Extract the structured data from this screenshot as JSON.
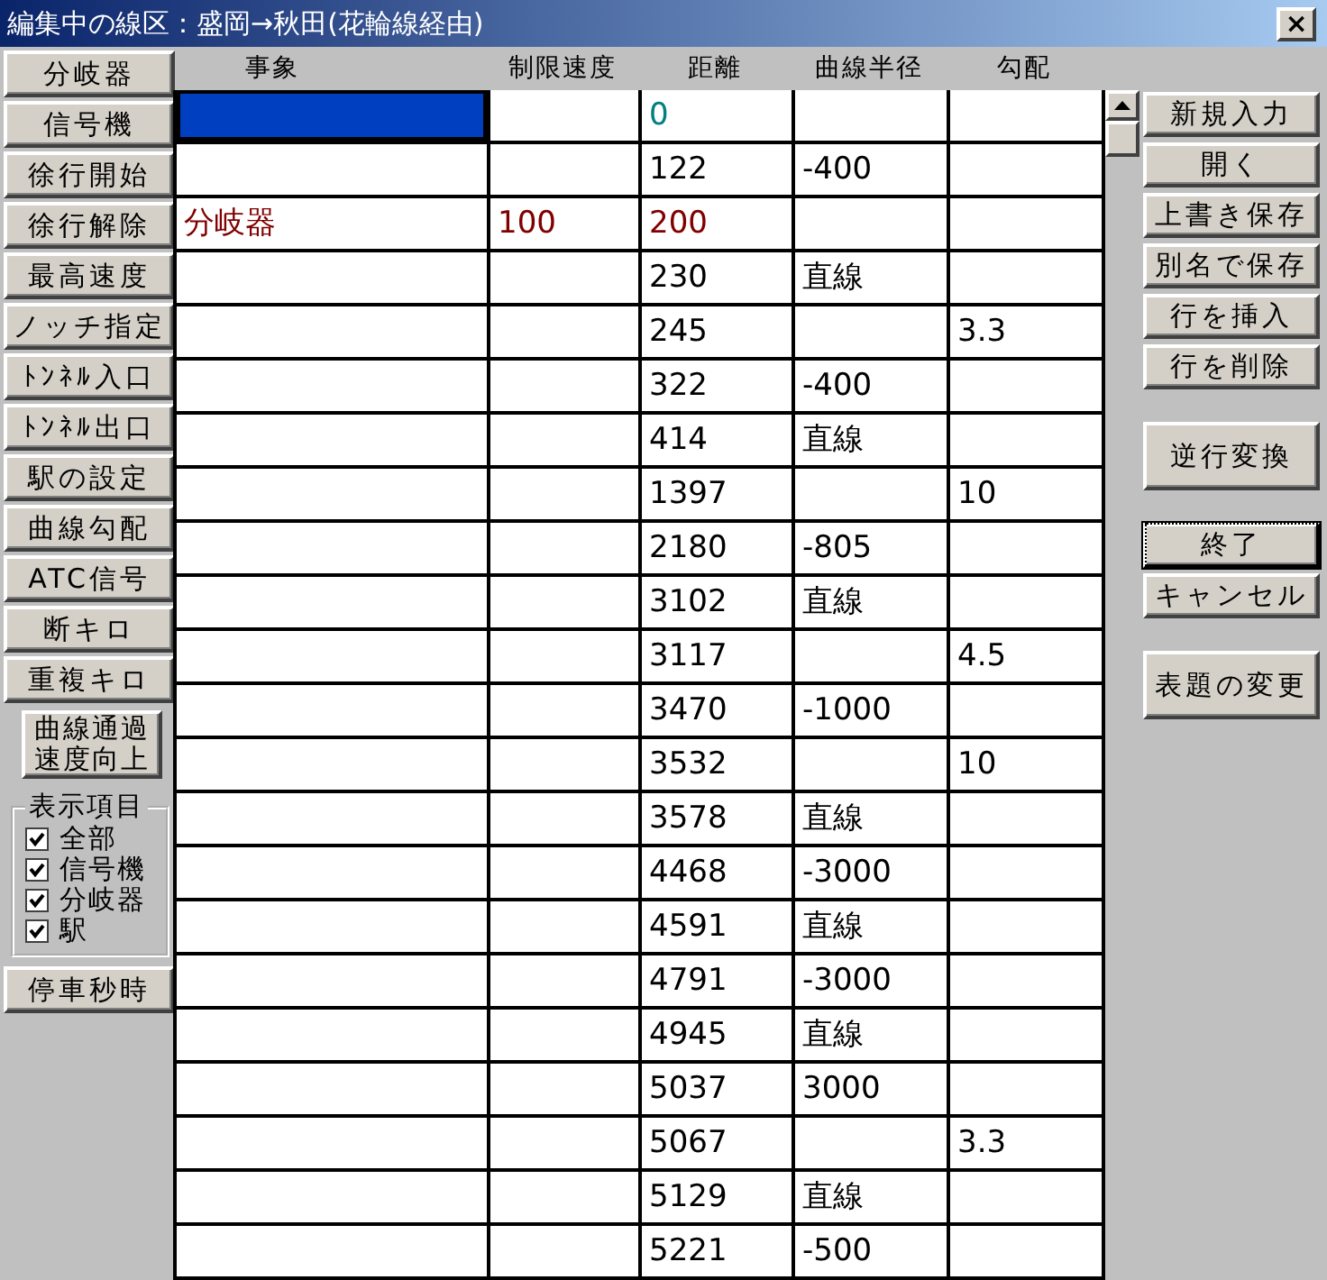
{
  "window": {
    "title": "編集中の線区：盛岡→秋田(花輪線経由)",
    "close": "×"
  },
  "left_buttons": [
    {
      "label": "分岐器",
      "kind": "normal"
    },
    {
      "label": "信号機",
      "kind": "normal"
    },
    {
      "label": "徐行開始",
      "kind": "normal"
    },
    {
      "label": "徐行解除",
      "kind": "normal"
    },
    {
      "label": "最高速度",
      "kind": "normal"
    },
    {
      "label": "ノッチ指定",
      "kind": "normal"
    },
    {
      "label": "ﾄﾝﾈﾙ入口",
      "kind": "normal"
    },
    {
      "label": "ﾄﾝﾈﾙ出口",
      "kind": "normal"
    },
    {
      "label": "駅の設定",
      "kind": "normal"
    },
    {
      "label": "曲線勾配",
      "kind": "normal"
    },
    {
      "label": "ATC信号",
      "kind": "normal"
    },
    {
      "label": "断キロ",
      "kind": "normal"
    },
    {
      "label": "重複キロ",
      "kind": "normal"
    },
    {
      "label": "曲線通過速度向上",
      "kind": "small"
    }
  ],
  "display_items": {
    "title": "表示項目",
    "items": [
      {
        "label": "全部",
        "checked": true
      },
      {
        "label": "信号機",
        "checked": true
      },
      {
        "label": "分岐器",
        "checked": true
      },
      {
        "label": "駅",
        "checked": true
      }
    ]
  },
  "bottom_button": {
    "label": "停車秒時"
  },
  "table": {
    "columns": [
      "事象",
      "制限速度",
      "距離",
      "曲線半径",
      "勾配"
    ],
    "rows": [
      {
        "cells": [
          "",
          "",
          "0",
          "",
          ""
        ],
        "selected": true,
        "color": "#008080"
      },
      {
        "cells": [
          "",
          "",
          "122",
          "-400",
          ""
        ],
        "selected": false,
        "color": "#000000"
      },
      {
        "cells": [
          "分岐器",
          "100",
          "200",
          "",
          ""
        ],
        "selected": false,
        "color": "#800000"
      },
      {
        "cells": [
          "",
          "",
          "230",
          "直線",
          ""
        ],
        "selected": false,
        "color": "#000000"
      },
      {
        "cells": [
          "",
          "",
          "245",
          "",
          "3.3"
        ],
        "selected": false,
        "color": "#000000"
      },
      {
        "cells": [
          "",
          "",
          "322",
          "-400",
          ""
        ],
        "selected": false,
        "color": "#000000"
      },
      {
        "cells": [
          "",
          "",
          "414",
          "直線",
          ""
        ],
        "selected": false,
        "color": "#000000"
      },
      {
        "cells": [
          "",
          "",
          "1397",
          "",
          "10"
        ],
        "selected": false,
        "color": "#000000"
      },
      {
        "cells": [
          "",
          "",
          "2180",
          "-805",
          ""
        ],
        "selected": false,
        "color": "#000000"
      },
      {
        "cells": [
          "",
          "",
          "3102",
          "直線",
          ""
        ],
        "selected": false,
        "color": "#000000"
      },
      {
        "cells": [
          "",
          "",
          "3117",
          "",
          "4.5"
        ],
        "selected": false,
        "color": "#000000"
      },
      {
        "cells": [
          "",
          "",
          "3470",
          "-1000",
          ""
        ],
        "selected": false,
        "color": "#000000"
      },
      {
        "cells": [
          "",
          "",
          "3532",
          "",
          "10"
        ],
        "selected": false,
        "color": "#000000"
      },
      {
        "cells": [
          "",
          "",
          "3578",
          "直線",
          ""
        ],
        "selected": false,
        "color": "#000000"
      },
      {
        "cells": [
          "",
          "",
          "4468",
          "-3000",
          ""
        ],
        "selected": false,
        "color": "#000000"
      },
      {
        "cells": [
          "",
          "",
          "4591",
          "直線",
          ""
        ],
        "selected": false,
        "color": "#000000"
      },
      {
        "cells": [
          "",
          "",
          "4791",
          "-3000",
          ""
        ],
        "selected": false,
        "color": "#000000"
      },
      {
        "cells": [
          "",
          "",
          "4945",
          "直線",
          ""
        ],
        "selected": false,
        "color": "#000000"
      },
      {
        "cells": [
          "",
          "",
          "5037",
          "3000",
          ""
        ],
        "selected": false,
        "color": "#000000"
      },
      {
        "cells": [
          "",
          "",
          "5067",
          "",
          "3.3"
        ],
        "selected": false,
        "color": "#000000"
      },
      {
        "cells": [
          "",
          "",
          "5129",
          "直線",
          ""
        ],
        "selected": false,
        "color": "#000000"
      },
      {
        "cells": [
          "",
          "",
          "5221",
          "-500",
          ""
        ],
        "selected": false,
        "color": "#000000"
      }
    ]
  },
  "right_button_groups": [
    [
      {
        "label": "新規入力",
        "kind": "normal",
        "default": false
      },
      {
        "label": "開く",
        "kind": "normal",
        "default": false
      },
      {
        "label": "上書き保存",
        "kind": "normal",
        "default": false
      },
      {
        "label": "別名で保存",
        "kind": "normal",
        "default": false
      },
      {
        "label": "行を挿入",
        "kind": "normal",
        "default": false
      },
      {
        "label": "行を削除",
        "kind": "normal",
        "default": false
      }
    ],
    [
      {
        "label": "逆行変換",
        "kind": "tall",
        "default": false
      }
    ],
    [
      {
        "label": "終了",
        "kind": "normal",
        "default": true
      },
      {
        "label": "キャンセル",
        "kind": "normal",
        "default": false
      }
    ],
    [
      {
        "label": "表題の変更",
        "kind": "tall",
        "default": false
      }
    ]
  ]
}
